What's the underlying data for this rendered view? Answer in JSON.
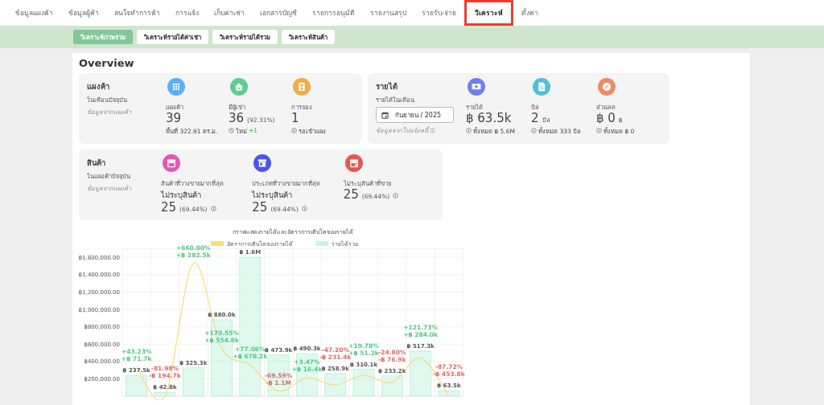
{
  "nav": {
    "tabs": [
      {
        "label": "ข้อมูลแผงค้า",
        "selected": false
      },
      {
        "label": "ข้อมูลผู้ค้า",
        "selected": false
      },
      {
        "label": "สนใจทำการค้า",
        "selected": false
      },
      {
        "label": "การแจ้ง",
        "selected": false
      },
      {
        "label": "เก็บค่าเช่า",
        "selected": false
      },
      {
        "label": "เอกสารบัญชี",
        "selected": false
      },
      {
        "label": "รายการอนุมัติ",
        "selected": false
      },
      {
        "label": "รายงานสรุป",
        "selected": false
      },
      {
        "label": "รายรับ-จ่าย",
        "selected": false
      },
      {
        "label": "วิเคราะห์",
        "selected": true
      },
      {
        "label": "ตั้งค่า",
        "selected": false
      }
    ]
  },
  "subnav": {
    "tabs": [
      {
        "label": "วิเคราะห์ภาพรวม",
        "selected": true
      },
      {
        "label": "วิเคราะห์รายได้ค่าเช่า",
        "selected": false
      },
      {
        "label": "วิเคราะห์รายได้รวม",
        "selected": false
      },
      {
        "label": "วิเคราะห์สินค้า",
        "selected": false
      }
    ]
  },
  "overview": {
    "title": "Overview",
    "sections": [
      {
        "title": "แผงค้า",
        "subtitle": "ในเดือนปัจจุบัน",
        "note": "ข้อมูลจากแผงค้า",
        "stats": [
          {
            "color": "#5aaef5",
            "label": "แผงค้า",
            "value": "39",
            "sub": "พื้นที่ 322.91 ตร.ม."
          },
          {
            "color": "#5ccf8e",
            "label": "มีผู้เช่า",
            "value": "36",
            "extra": "(92.31%)",
            "footer": "ใหม่",
            "delta": "+1"
          },
          {
            "color": "#f0ad45",
            "label": "การจอง",
            "value": "1",
            "footer": "รอเข้าแผง"
          }
        ]
      },
      {
        "title": "รายได้",
        "subtitle": "รายได้ในเดือน",
        "date": "กันยายน / 2025",
        "note": "ข้อมูลจากใบแจ้งหนี้",
        "stats": [
          {
            "color": "#6b7ff0",
            "label": "รายได้",
            "value": "฿ 63.5k",
            "footer": "ทั้งหมด ฿ 5.6M"
          },
          {
            "color": "#4fc0d6",
            "label": "บิล",
            "value": "2",
            "unit": "บิล",
            "footer": "ทั้งหมด 333 บิล"
          },
          {
            "color": "#ee8a67",
            "label": "ส่วนลด",
            "value": "฿ 0",
            "unit": "฿",
            "footer": "ทั้งหมด ฿ 0"
          }
        ]
      },
      {
        "title": "สินค้า",
        "subtitle": "ในแผงค้าปัจจุบัน",
        "note": "ข้อมูลจากแผงค้า",
        "stats": [
          {
            "color": "#e356b8",
            "label": "สินค้าที่วางขายมากที่สุด",
            "name": "ไม่ระบุสินค้า",
            "value": "25",
            "extra": "(69.44%)"
          },
          {
            "color": "#4a55e8",
            "label": "ประเภทที่วางขายมากที่สุด",
            "name": "ไม่ระบุสินค้า",
            "value": "25",
            "extra": "(69.44%)"
          },
          {
            "color": "#e5574f",
            "label": "ไม่ระบุสินค้าที่ขาย",
            "value": "25",
            "extra": "(69.44%)"
          }
        ]
      }
    ]
  },
  "chart": {
    "chart_data": {
      "type": "bar",
      "title": "กราฟแสดงรายได้และอัตราการเติบโตของรายได้",
      "grid": true,
      "legend": true,
      "series": [
        {
          "name": "อัตราการเติบโตของรายได้",
          "type": "line",
          "color": "#f7df7c",
          "values": [
            330000,
            0,
            1530000,
            550000,
            360000,
            60000,
            210000,
            130000,
            240000,
            160000,
            440000,
            0
          ]
        },
        {
          "name": "รายได้รวม",
          "type": "bar",
          "color": "#c9f5e4",
          "values": [
            237500,
            42800,
            325300,
            880000,
            1600000,
            473900,
            490300,
            258900,
            310100,
            233200,
            517300,
            63500
          ]
        }
      ],
      "value_labels": [
        "฿ 237.5k",
        "฿ 42.8k",
        "฿ 325.3k",
        "฿ 880.0k",
        "฿ 1.6M",
        "฿ 473.9k",
        "฿ 490.3k",
        "฿ 258.9k",
        "฿ 310.1k",
        "฿ 233.2k",
        "฿ 517.3k",
        "฿ 63.5k"
      ],
      "ylim": [
        0,
        1600000
      ],
      "yticks": [
        {
          "value": 200000,
          "label": "฿200,000.00"
        },
        {
          "value": 400000,
          "label": "฿400,000.00"
        },
        {
          "value": 600000,
          "label": "฿600,000.00"
        },
        {
          "value": 800000,
          "label": "฿800,000.00"
        },
        {
          "value": 1000000,
          "label": "฿1,000,000.00"
        },
        {
          "value": 1200000,
          "label": "฿1,200,000.00"
        },
        {
          "value": 1400000,
          "label": "฿1,400,000.00"
        },
        {
          "value": 1600000,
          "label": "฿1,600,000.00"
        }
      ]
    },
    "growth_labels": [
      {
        "percent": "+43.23%",
        "amount": "+฿ 71.7k",
        "color": "#4fca86"
      },
      {
        "percent": "-81.98%",
        "amount": "-฿ 194.7k",
        "color": "#e06a68"
      },
      {
        "percent": "+660.00%",
        "amount": "+฿ 282.5k",
        "color": "#4fca86"
      },
      {
        "percent": "+170.55%",
        "amount": "+฿ 554.8k",
        "color": "#4fca86"
      },
      {
        "percent": "+77.06%",
        "amount": "+฿ 678.2k",
        "color": "#4fca86"
      },
      {
        "percent": "-69.59%",
        "amount": "-฿ 1.1M",
        "color": "#e06a68"
      },
      {
        "percent": "+3.47%",
        "amount": "+฿ 16.4k",
        "color": "#4fca86"
      },
      {
        "percent": "-47.20%",
        "amount": "-฿ 231.4k",
        "color": "#e06a68"
      },
      {
        "percent": "+19.78%",
        "amount": "+฿ 51.2k",
        "color": "#4fca86"
      },
      {
        "percent": "-24.80%",
        "amount": "-฿ 76.9k",
        "color": "#e06a68"
      },
      {
        "percent": "+121.73%",
        "amount": "+฿ 284.0k",
        "color": "#4fca86"
      },
      {
        "percent": "-87.72%",
        "amount": "-฿ 453.8k",
        "color": "#e06a68"
      }
    ]
  }
}
